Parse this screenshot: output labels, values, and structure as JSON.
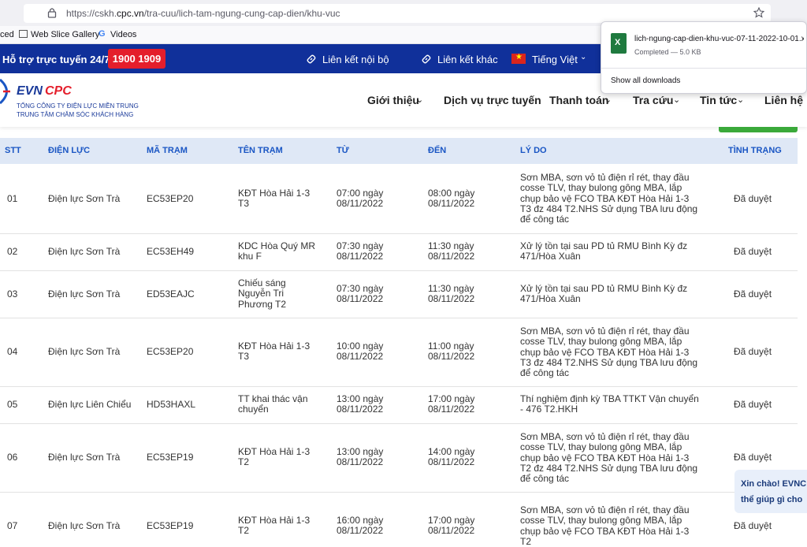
{
  "browser": {
    "url_prefix": "https://cskh.",
    "url_domain": "cpc.vn",
    "url_path": "/tra-cuu/lich-tam-ngung-cung-cap-dien/khu-vuc",
    "bookmarks": [
      "ced",
      "Web Slice Gallery",
      "Videos"
    ]
  },
  "downloads": {
    "filename": "lich-ngung-cap-dien-khu-vuc-07-11-2022-10-01.x",
    "status": "Completed — 5.0 KB",
    "show_all": "Show all downloads"
  },
  "topbar": {
    "hotline_label": "Hỗ trợ trực tuyến 24/7:",
    "hotline_number": "1900 1909",
    "link1": "Liên kết nội bộ",
    "link2": "Liên kết khác",
    "language": "Tiếng Việt"
  },
  "brand": {
    "logo_evn": "EVN",
    "logo_cpc": "CPC",
    "line1": "TỔNG CÔNG TY ĐIỆN LỰC MIỀN TRUNG",
    "line2": "TRUNG TÂM CHĂM SÓC KHÁCH HÀNG"
  },
  "nav": [
    "Giới thiệu",
    "Dịch vụ trực tuyến",
    "Thanh toán",
    "Tra cứu",
    "Tin tức",
    "Liên hệ"
  ],
  "table": {
    "headers": [
      "STT",
      "ĐIỆN LỰC",
      "MÃ TRẠM",
      "TÊN TRẠM",
      "TỪ",
      "ĐẾN",
      "LÝ DO",
      "TÌNH TRẠNG"
    ],
    "rows": [
      {
        "stt": "01",
        "dienluc": "Điện lực Sơn Trà",
        "ma": "EC53EP20",
        "ten": "KĐT Hòa Hải 1-3 T3",
        "tu": "07:00 ngày 08/11/2022",
        "den": "08:00 ngày 08/11/2022",
        "lydo": "Sơn MBA, sơn vỏ tủ điện rỉ rét, thay đầu cosse TLV, thay bulong gông MBA, lắp chụp bảo vệ FCO TBA KĐT Hòa Hải 1-3 T3 đz 484 T2.NHS Sử dụng TBA lưu động để công tác",
        "tt": "Đã duyệt"
      },
      {
        "stt": "02",
        "dienluc": "Điện lực Sơn Trà",
        "ma": "EC53EH49",
        "ten": "KDC Hòa Quý MR khu F",
        "tu": "07:30 ngày 08/11/2022",
        "den": "11:30 ngày 08/11/2022",
        "lydo": "Xử lý tồn tại sau PD tủ RMU Bình Kỳ đz 471/Hòa Xuân",
        "tt": "Đã duyệt"
      },
      {
        "stt": "03",
        "dienluc": "Điện lực Sơn Trà",
        "ma": "ED53EAJC",
        "ten": "Chiếu sáng Nguyễn Tri Phương T2",
        "tu": "07:30 ngày 08/11/2022",
        "den": "11:30 ngày 08/11/2022",
        "lydo": "Xử lý tồn tại sau PD tủ RMU Bình Kỳ đz 471/Hòa Xuân",
        "tt": "Đã duyệt"
      },
      {
        "stt": "04",
        "dienluc": "Điện lực Sơn Trà",
        "ma": "EC53EP20",
        "ten": "KĐT Hòa Hải 1-3 T3",
        "tu": "10:00 ngày 08/11/2022",
        "den": "11:00 ngày 08/11/2022",
        "lydo": "Sơn MBA, sơn vỏ tủ điện rỉ rét, thay đầu cosse TLV, thay bulong gông MBA, lắp chụp bảo vệ FCO TBA KĐT Hòa Hải 1-3 T3 đz 484 T2.NHS Sử dụng TBA lưu động để công tác",
        "tt": "Đã duyệt"
      },
      {
        "stt": "05",
        "dienluc": "Điện lực Liên Chiểu",
        "ma": "HD53HAXL",
        "ten": "TT khai thác vận chuyển",
        "tu": "13:00 ngày 08/11/2022",
        "den": "17:00 ngày 08/11/2022",
        "lydo": "Thí nghiệm định kỳ TBA TTKT Vận chuyển - 476 T2.HKH",
        "tt": "Đã duyệt"
      },
      {
        "stt": "06",
        "dienluc": "Điện lực Sơn Trà",
        "ma": "EC53EP19",
        "ten": "KĐT Hòa Hải 1-3 T2",
        "tu": "13:00 ngày 08/11/2022",
        "den": "14:00 ngày 08/11/2022",
        "lydo": "Sơn MBA, sơn vỏ tủ điện rỉ rét, thay đầu cosse TLV, thay bulong gông MBA, lắp chụp bảo vệ FCO TBA KĐT Hòa Hải 1-3 T2 đz 484 T2.NHS Sử dụng TBA lưu động để công tác",
        "tt": "Đã duyệt"
      },
      {
        "stt": "07",
        "dienluc": "Điện lực Sơn Trà",
        "ma": "EC53EP19",
        "ten": "KĐT Hòa Hải 1-3 T2",
        "tu": "16:00 ngày 08/11/2022",
        "den": "17:00 ngày 08/11/2022",
        "lydo": "Sơn MBA, sơn vỏ tủ điện rỉ rét, thay đầu cosse TLV, thay bulong gông MBA, lắp chụp bảo vệ FCO TBA KĐT Hòa Hải 1-3 T2",
        "tt": "Đã duyệt"
      }
    ]
  },
  "chat": {
    "line1": "Xin chào! EVNC",
    "line2": "thể giúp gì cho"
  },
  "colors": {
    "topbar": "#10309a",
    "hotline": "#e41e2b",
    "table_header": "#dfe8f6",
    "header_text": "#1a56c4",
    "green_button": "#3aa93a"
  }
}
